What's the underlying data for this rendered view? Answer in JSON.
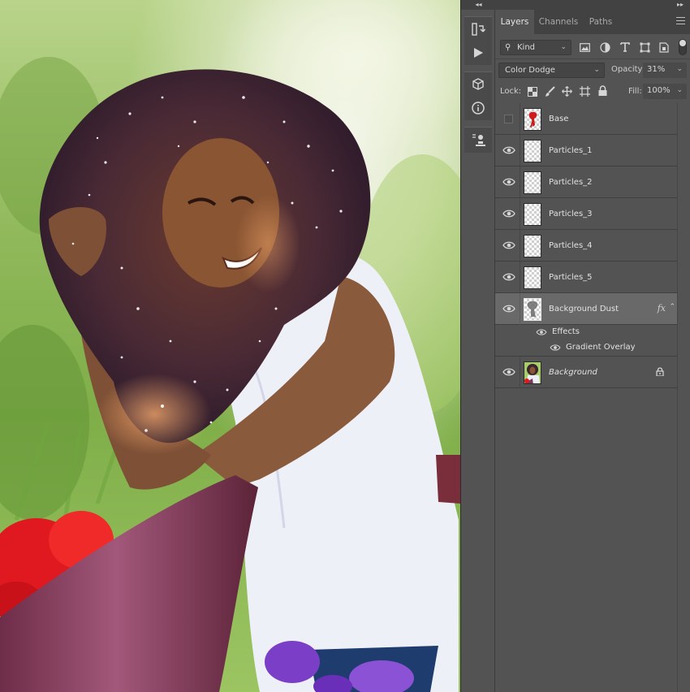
{
  "canvas": {
    "description_colors": {
      "background": "#8fb85a",
      "shirt": "#eef0f8",
      "rail": "#7a3a55",
      "flowers": "#e4232a"
    }
  },
  "dock": {
    "collapse_glyph": "◂◂",
    "tools": [
      {
        "icon": "history-icon"
      },
      {
        "icon": "actions-play-icon"
      },
      {
        "icon": "3d-icon"
      },
      {
        "icon": "info-icon"
      },
      {
        "icon": "clone-source-icon"
      }
    ]
  },
  "panel": {
    "collapse_glyph": "▸▸",
    "tabs": [
      {
        "label": "Layers",
        "active": true
      },
      {
        "label": "Channels",
        "active": false
      },
      {
        "label": "Paths",
        "active": false
      }
    ],
    "filter": {
      "kind_label": "Kind",
      "filter_icons": [
        "image-filter-icon",
        "adjustment-filter-icon",
        "type-filter-icon",
        "shape-filter-icon",
        "smart-object-filter-icon"
      ]
    },
    "blend_mode": "Color Dodge",
    "opacity_label": "Opacity:",
    "opacity_value": "31%",
    "lock_label": "Lock:",
    "fill_label": "Fill:",
    "fill_value": "100%",
    "layers": [
      {
        "name": "Base",
        "visible": false,
        "thumb": "base"
      },
      {
        "name": "Particles_1",
        "visible": true,
        "thumb": "transparent"
      },
      {
        "name": "Particles_2",
        "visible": true,
        "thumb": "transparent"
      },
      {
        "name": "Particles_3",
        "visible": true,
        "thumb": "transparent"
      },
      {
        "name": "Particles_4",
        "visible": true,
        "thumb": "transparent"
      },
      {
        "name": "Particles_5",
        "visible": true,
        "thumb": "transparent"
      },
      {
        "name": "Background Dust",
        "visible": true,
        "selected": true,
        "thumb": "dust",
        "has_fx": true
      },
      {
        "name": "Background",
        "visible": true,
        "italic": true,
        "locked": true,
        "thumb": "photo"
      }
    ],
    "effects_label": "Effects",
    "effect_items": [
      "Gradient Overlay"
    ]
  }
}
